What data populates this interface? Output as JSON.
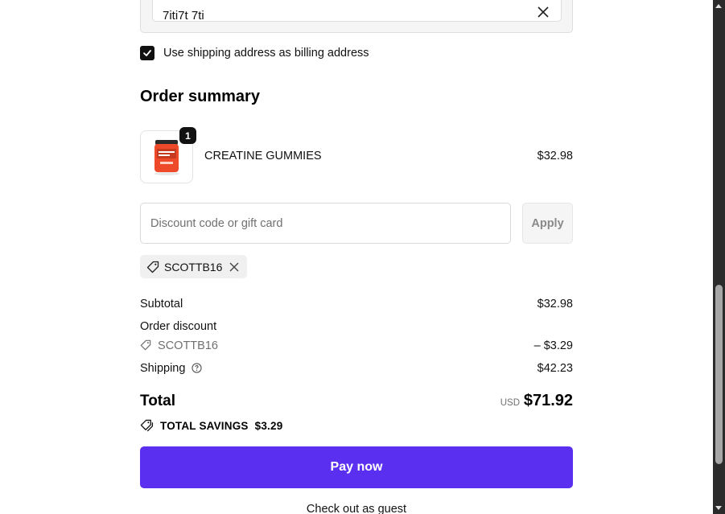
{
  "address": {
    "value": "7iti7t 7ti"
  },
  "billing": {
    "checkbox_label": "Use shipping address as billing address",
    "checked": true
  },
  "order_summary": {
    "title": "Order summary",
    "item": {
      "name": "CREATINE GUMMIES",
      "price": "$32.98",
      "quantity": "1"
    }
  },
  "discount": {
    "placeholder": "Discount code or gift card",
    "apply_label": "Apply",
    "applied_code": "SCOTTB16"
  },
  "totals": {
    "subtotal_label": "Subtotal",
    "subtotal_value": "$32.98",
    "order_discount_label": "Order discount",
    "discount_code": "SCOTTB16",
    "discount_value": "– $3.29",
    "shipping_label": "Shipping",
    "shipping_value": "$42.23",
    "total_label": "Total",
    "currency": "USD",
    "total_value": "$71.92",
    "savings_label": "TOTAL SAVINGS",
    "savings_value": "$3.29"
  },
  "actions": {
    "pay_label": "Pay now",
    "guest_label": "Check out as guest"
  },
  "colors": {
    "accent": "#5b2ff0",
    "text": "#111111",
    "muted": "#707070"
  }
}
